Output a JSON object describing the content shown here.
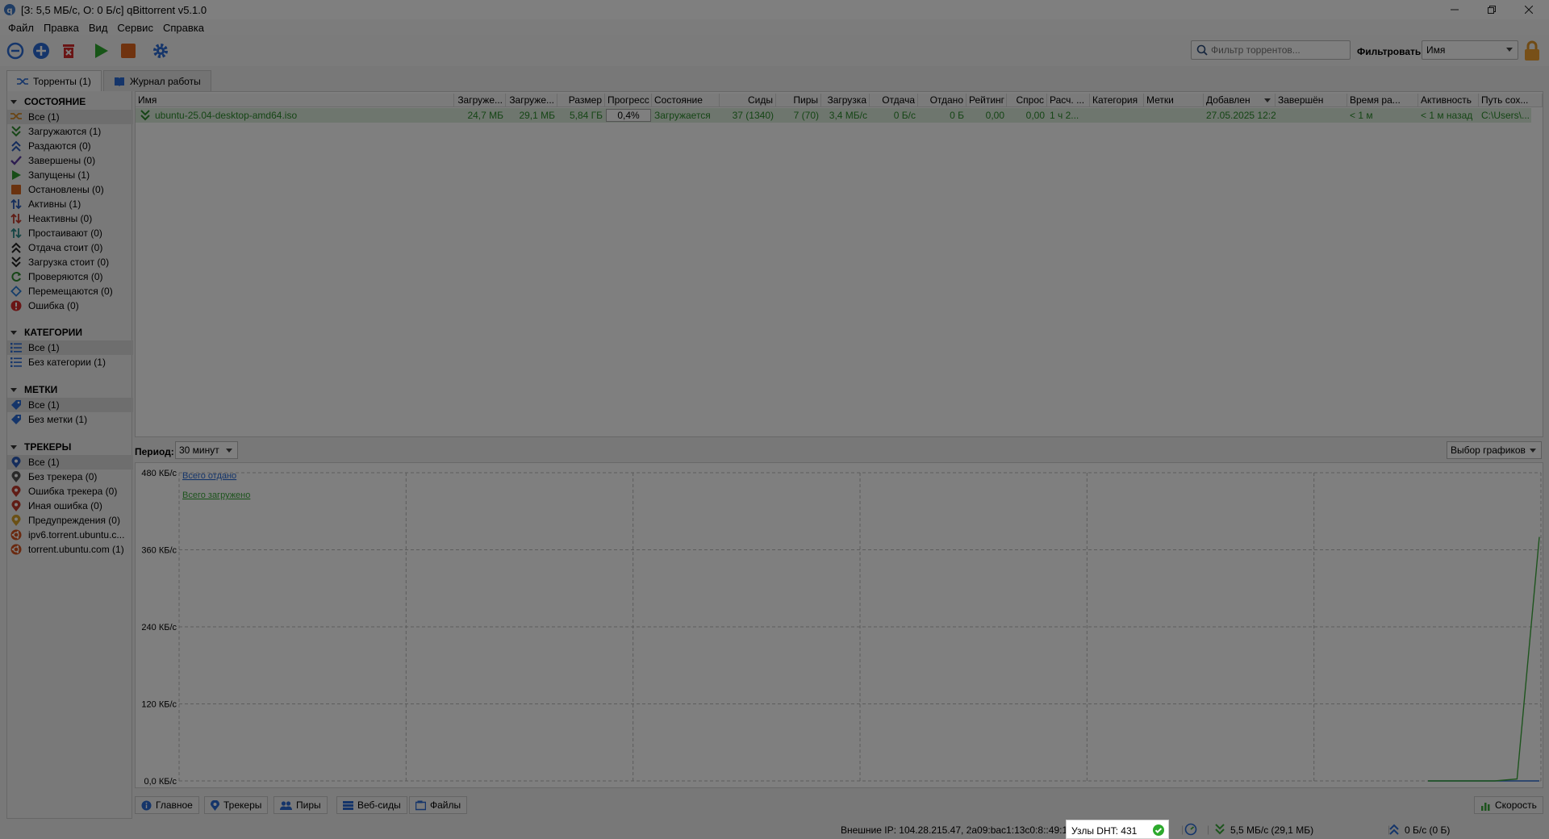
{
  "window": {
    "title": "[З: 5,5 МБ/с, О: 0 Б/с] qBittorrent v5.1.0"
  },
  "menu": [
    "Файл",
    "Правка",
    "Вид",
    "Сервис",
    "Справка"
  ],
  "toolbar": {
    "search_placeholder": "Фильтр торрентов...",
    "filter_label": "Фильтровать:",
    "filter_value": "Имя"
  },
  "top_tabs": [
    {
      "label": "Торренты (1)",
      "active": true
    },
    {
      "label": "Журнал работы",
      "active": false
    }
  ],
  "sidebar": {
    "status_header": "СОСТОЯНИЕ",
    "status_items": [
      {
        "label": "Все (1)",
        "icon": "all-torrents-icon",
        "color": "#d48a2a"
      },
      {
        "label": "Загружаются (1)",
        "icon": "downloading-icon",
        "color": "#2e8b2e"
      },
      {
        "label": "Раздаются (0)",
        "icon": "seeding-icon",
        "color": "#2a5bb8"
      },
      {
        "label": "Завершены (0)",
        "icon": "completed-check-icon",
        "color": "#5a3aa0"
      },
      {
        "label": "Запущены (1)",
        "icon": "running-play-icon",
        "color": "#2e9a2e"
      },
      {
        "label": "Остановлены (0)",
        "icon": "stopped-square-icon",
        "color": "#d4651e"
      },
      {
        "label": "Активны (1)",
        "icon": "active-arrows-icon",
        "color": "#2a5bb8"
      },
      {
        "label": "Неактивны (0)",
        "icon": "inactive-arrows-icon",
        "color": "#c0392b"
      },
      {
        "label": "Простаивают (0)",
        "icon": "stalled-arrows-icon",
        "color": "#2a8a8a"
      },
      {
        "label": "Отдача стоит (0)",
        "icon": "stalled-upload-icon",
        "color": "#222222"
      },
      {
        "label": "Загрузка стоит (0)",
        "icon": "stalled-download-icon",
        "color": "#222222"
      },
      {
        "label": "Проверяются (0)",
        "icon": "checking-icon",
        "color": "#2e8b2e"
      },
      {
        "label": "Перемещаются (0)",
        "icon": "moving-icon",
        "color": "#2a7bd4"
      },
      {
        "label": "Ошибка (0)",
        "icon": "error-icon",
        "color": "#d42a2a"
      }
    ],
    "categories_header": "КАТЕГОРИИ",
    "category_items": [
      {
        "label": "Все (1)",
        "icon": "list-icon"
      },
      {
        "label": "Без категории (1)",
        "icon": "list-icon"
      }
    ],
    "tags_header": "МЕТКИ",
    "tag_items": [
      {
        "label": "Все (1)",
        "icon": "tag-icon"
      },
      {
        "label": "Без метки (1)",
        "icon": "tag-icon"
      }
    ],
    "trackers_header": "ТРЕКЕРЫ",
    "tracker_items": [
      {
        "label": "Все (1)",
        "icon": "tracker-pin-icon",
        "color": "#2a5bb8"
      },
      {
        "label": "Без трекера (0)",
        "icon": "tracker-pin-icon",
        "color": "#555555"
      },
      {
        "label": "Ошибка трекера (0)",
        "icon": "tracker-pin-icon",
        "color": "#c0392b"
      },
      {
        "label": "Иная ошибка (0)",
        "icon": "tracker-pin-icon",
        "color": "#c0392b"
      },
      {
        "label": "Предупреждения (0)",
        "icon": "tracker-pin-icon",
        "color": "#d4a02a"
      },
      {
        "label": "ipv6.torrent.ubuntu.c...",
        "icon": "ubuntu-logo-icon",
        "color": "#d4521e"
      },
      {
        "label": "torrent.ubuntu.com (1)",
        "icon": "ubuntu-logo-icon",
        "color": "#d4521e"
      }
    ]
  },
  "table": {
    "columns": [
      "Имя",
      "Загруже...",
      "Загруже...",
      "Размер",
      "Прогресс",
      "Состояние",
      "Сиды",
      "Пиры",
      "Загрузка",
      "Отдача",
      "Отдано",
      "Рейтинг",
      "Спрос",
      "Расч. ...",
      "Категория",
      "Метки",
      "Добавлен",
      "Завершён",
      "Время ра...",
      "Активность",
      "Путь сох..."
    ],
    "rows": [
      {
        "name": "ubuntu-25.04-desktop-amd64.iso",
        "downloaded": "24,7 МБ",
        "downloaded_session": "29,1 МБ",
        "size": "5,84 ГБ",
        "progress": "0,4%",
        "state": "Загружается",
        "seeds": "37 (1340)",
        "peers": "7 (70)",
        "down_speed": "3,4 МБ/с",
        "up_speed": "0 Б/с",
        "uploaded": "0 Б",
        "ratio": "0,00",
        "availability": "0,00",
        "eta": "1 ч 2...",
        "category": "",
        "tags": "",
        "added": "27.05.2025 12:25",
        "completed": "",
        "time_active": "< 1 м",
        "last_activity": "< 1 м назад",
        "save_path": "C:\\Users\\..."
      }
    ]
  },
  "graph": {
    "period_label": "Период:",
    "period_value": "30 минут",
    "select_label": "Выбор графиков",
    "legend_upload": "Всего отдано",
    "legend_download": "Всего загружено",
    "upload_color": "#2a6bd4",
    "download_color": "#3aa83a",
    "y_ticks": [
      "480 КБ/с",
      "360 КБ/с",
      "240 КБ/с",
      "120 КБ/с",
      "0,0 КБ/с"
    ]
  },
  "chart_data": {
    "type": "line",
    "title": "",
    "xlabel": "",
    "ylabel": "",
    "ylim": [
      0,
      480
    ],
    "y_unit": "КБ/с",
    "grid": true,
    "series": [
      {
        "name": "Всего отдано",
        "values": [
          0,
          0,
          0,
          0,
          0
        ]
      },
      {
        "name": "Всего загружено",
        "values": [
          0,
          0,
          0,
          0,
          3,
          380
        ]
      }
    ]
  },
  "bottom_tabs": [
    {
      "label": "Главное",
      "icon": "info-icon"
    },
    {
      "label": "Трекеры",
      "icon": "tracker-pin-icon"
    },
    {
      "label": "Пиры",
      "icon": "peers-icon"
    },
    {
      "label": "Веб-сиды",
      "icon": "web-seeds-icon"
    },
    {
      "label": "Файлы",
      "icon": "files-icon"
    }
  ],
  "speed_button": "Скорость",
  "status": {
    "external_ip": "Внешние IP: 104.28.215.47, 2a09:bac1:13c0:8::49:106",
    "dht": "Узлы DHT: 431",
    "download": "5,5 МБ/с (29,1 МБ)",
    "upload": "0 Б/с (0 Б)"
  }
}
